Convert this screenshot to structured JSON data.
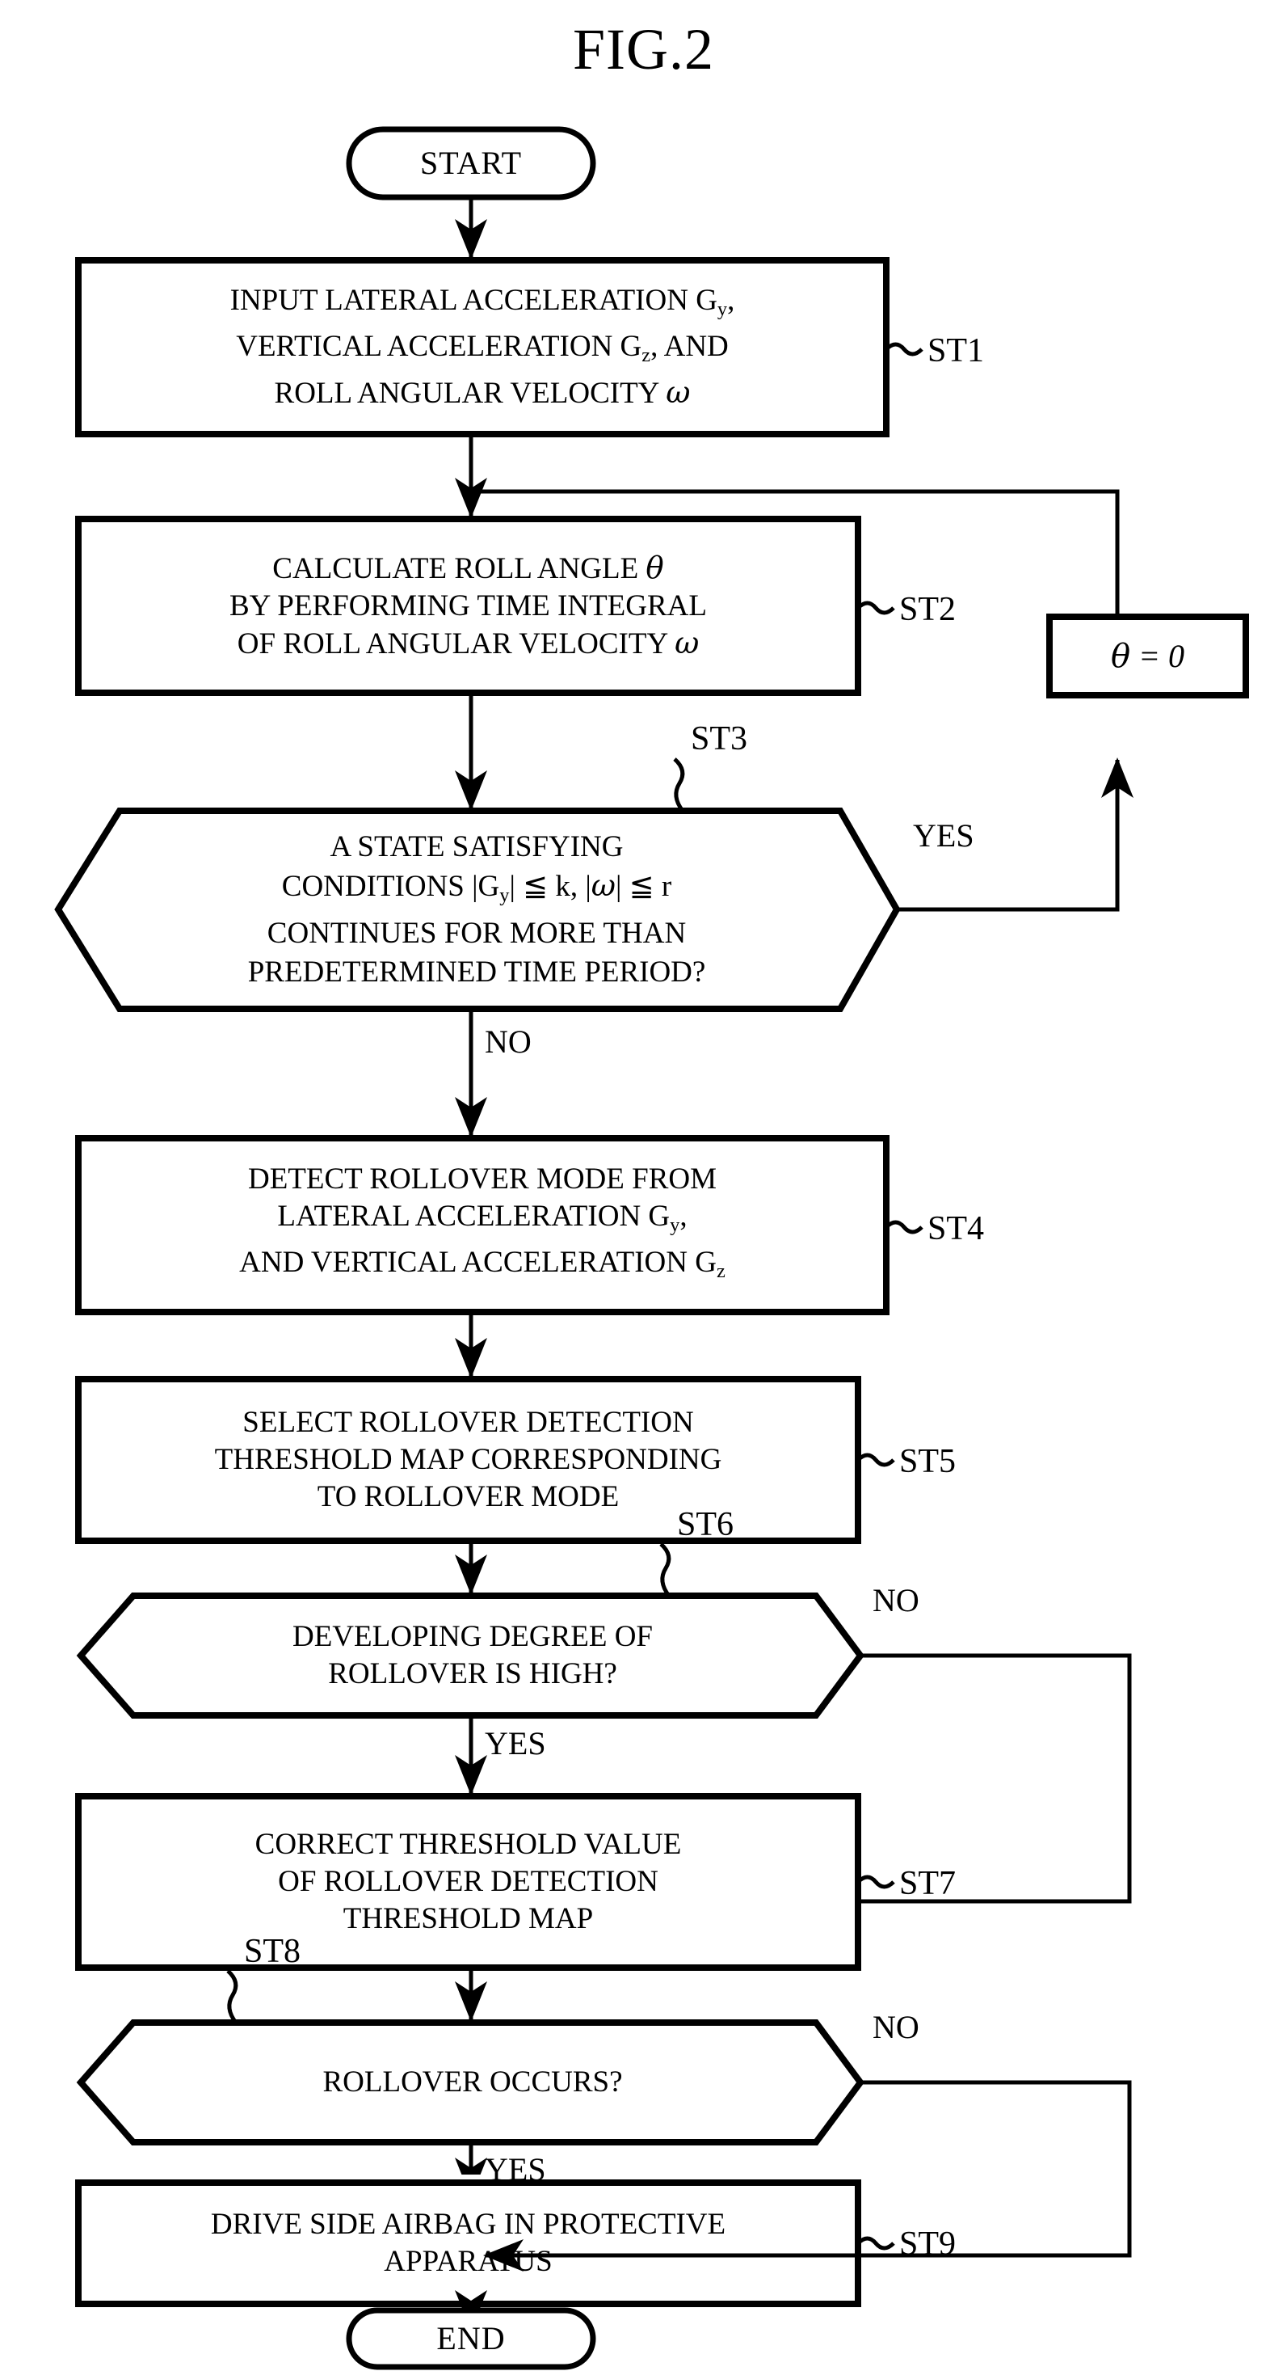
{
  "figure": {
    "title": "FIG.2"
  },
  "terminals": {
    "start": "START",
    "end": "END"
  },
  "nodes": [
    {
      "id": "ST1",
      "shape": "process",
      "label": "ST1",
      "lines": [
        "INPUT LATERAL ACCELERATION Gy,",
        "VERTICAL ACCELERATION Gz, AND",
        "ROLL ANGULAR VELOCITY ω"
      ]
    },
    {
      "id": "ST2",
      "shape": "process",
      "label": "ST2",
      "lines": [
        "CALCULATE ROLL ANGLE θ",
        "BY PERFORMING TIME INTEGRAL",
        "OF ROLL ANGULAR VELOCITY ω"
      ]
    },
    {
      "id": "ST3",
      "shape": "decision",
      "label": "ST3",
      "lines": [
        "A STATE SATISFYING",
        "CONDITIONS |Gy| ≦ k, |ω| ≦ r",
        "CONTINUES FOR MORE THAN",
        "PREDETERMINED TIME PERIOD?"
      ]
    },
    {
      "id": "ST4",
      "shape": "process",
      "label": "ST4",
      "lines": [
        "DETECT ROLLOVER MODE FROM",
        "LATERAL ACCELERATION Gy,",
        "AND VERTICAL ACCELERATION Gz"
      ]
    },
    {
      "id": "ST5",
      "shape": "process",
      "label": "ST5",
      "lines": [
        "SELECT ROLLOVER DETECTION",
        "THRESHOLD MAP CORRESPONDING",
        "TO ROLLOVER MODE"
      ]
    },
    {
      "id": "ST6",
      "shape": "decision",
      "label": "ST6",
      "lines": [
        "DEVELOPING DEGREE OF",
        "ROLLOVER IS HIGH?"
      ]
    },
    {
      "id": "ST7",
      "shape": "process",
      "label": "ST7",
      "lines": [
        "CORRECT THRESHOLD VALUE",
        "OF ROLLOVER DETECTION",
        "THRESHOLD MAP"
      ]
    },
    {
      "id": "ST8",
      "shape": "decision",
      "label": "ST8",
      "lines": [
        "ROLLOVER OCCURS?"
      ]
    },
    {
      "id": "ST9",
      "shape": "process",
      "label": "ST9",
      "lines": [
        "DRIVE SIDE AIRBAG IN PROTECTIVE",
        "APPARATUS"
      ]
    },
    {
      "id": "RESET",
      "shape": "process",
      "label": "",
      "lines": [
        "θ = 0"
      ]
    }
  ],
  "reset_box": {
    "expression": "θ = 0"
  },
  "edge_labels": {
    "st3_yes": "YES",
    "st3_no": "NO",
    "st6_no": "NO",
    "st6_yes": "YES",
    "st8_no": "NO",
    "st8_yes": "YES"
  },
  "step_labels": {
    "st1": "ST1",
    "st2": "ST2",
    "st3": "ST3",
    "st4": "ST4",
    "st5": "ST5",
    "st6": "ST6",
    "st7": "ST7",
    "st8": "ST8",
    "st9": "ST9"
  },
  "colors": {
    "stroke": "#000000",
    "background": "#ffffff",
    "text": "#000000"
  }
}
